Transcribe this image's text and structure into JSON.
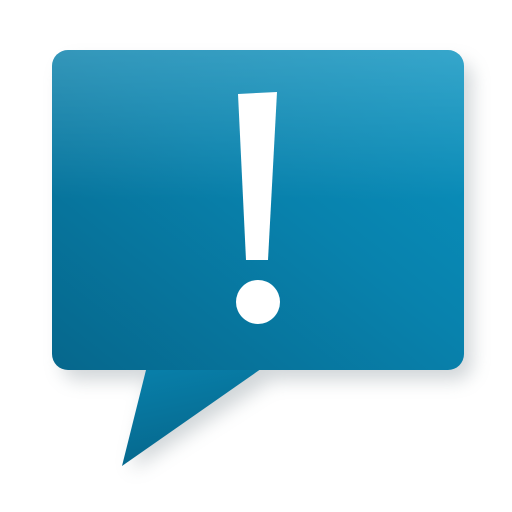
{
  "icon": {
    "name": "alert-speech-bubble-icon",
    "glyph": "!",
    "colors": {
      "bubble_light": "#0a93c0",
      "bubble_mid": "#0882ad",
      "bubble_dark": "#06678c",
      "glyph": "#ffffff",
      "shadow": "#9aa4aa",
      "background": "#ffffff"
    }
  }
}
